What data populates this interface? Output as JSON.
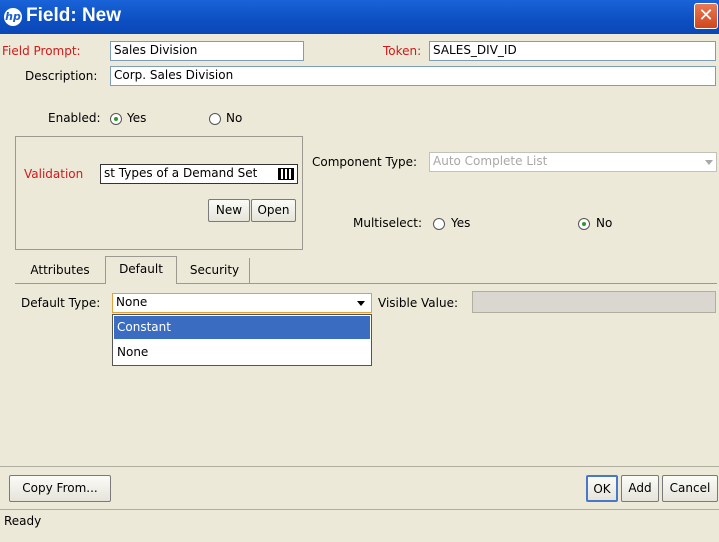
{
  "window": {
    "title": "Field: New",
    "logo": "hp",
    "close_glyph": "✕"
  },
  "form": {
    "field_prompt": {
      "label": "Field Prompt:",
      "value": "Sales Division"
    },
    "token": {
      "label": "Token:",
      "value": "SALES_DIV_ID"
    },
    "description": {
      "label": "Description:",
      "value": "Corp. Sales Division"
    },
    "enabled": {
      "label": "Enabled:",
      "yes": "Yes",
      "no": "No",
      "selected": "Yes"
    },
    "validation": {
      "label": "Validation",
      "value": "st Types of a Demand Set",
      "new_label": "New",
      "open_label": "Open"
    },
    "component_type": {
      "label": "Component Type:",
      "value": "Auto Complete List"
    },
    "multiselect": {
      "label": "Multiselect:",
      "yes": "Yes",
      "no": "No",
      "selected": "No"
    }
  },
  "tabs": [
    {
      "label": "Attributes"
    },
    {
      "label": "Default"
    },
    {
      "label": "Security"
    }
  ],
  "default_tab": {
    "default_type": {
      "label": "Default Type:",
      "value": "None"
    },
    "visible_value": {
      "label": "Visible Value:",
      "value": ""
    },
    "options": [
      {
        "label": "Constant"
      },
      {
        "label": "None"
      }
    ]
  },
  "buttons": {
    "copy_from": "Copy From...",
    "ok": "OK",
    "add": "Add",
    "cancel": "Cancel"
  },
  "status": {
    "text": "Ready"
  },
  "colors": {
    "title_bar": "#0d4fc2",
    "required_label": "#d11a1a",
    "selection": "#3a6dc2"
  }
}
